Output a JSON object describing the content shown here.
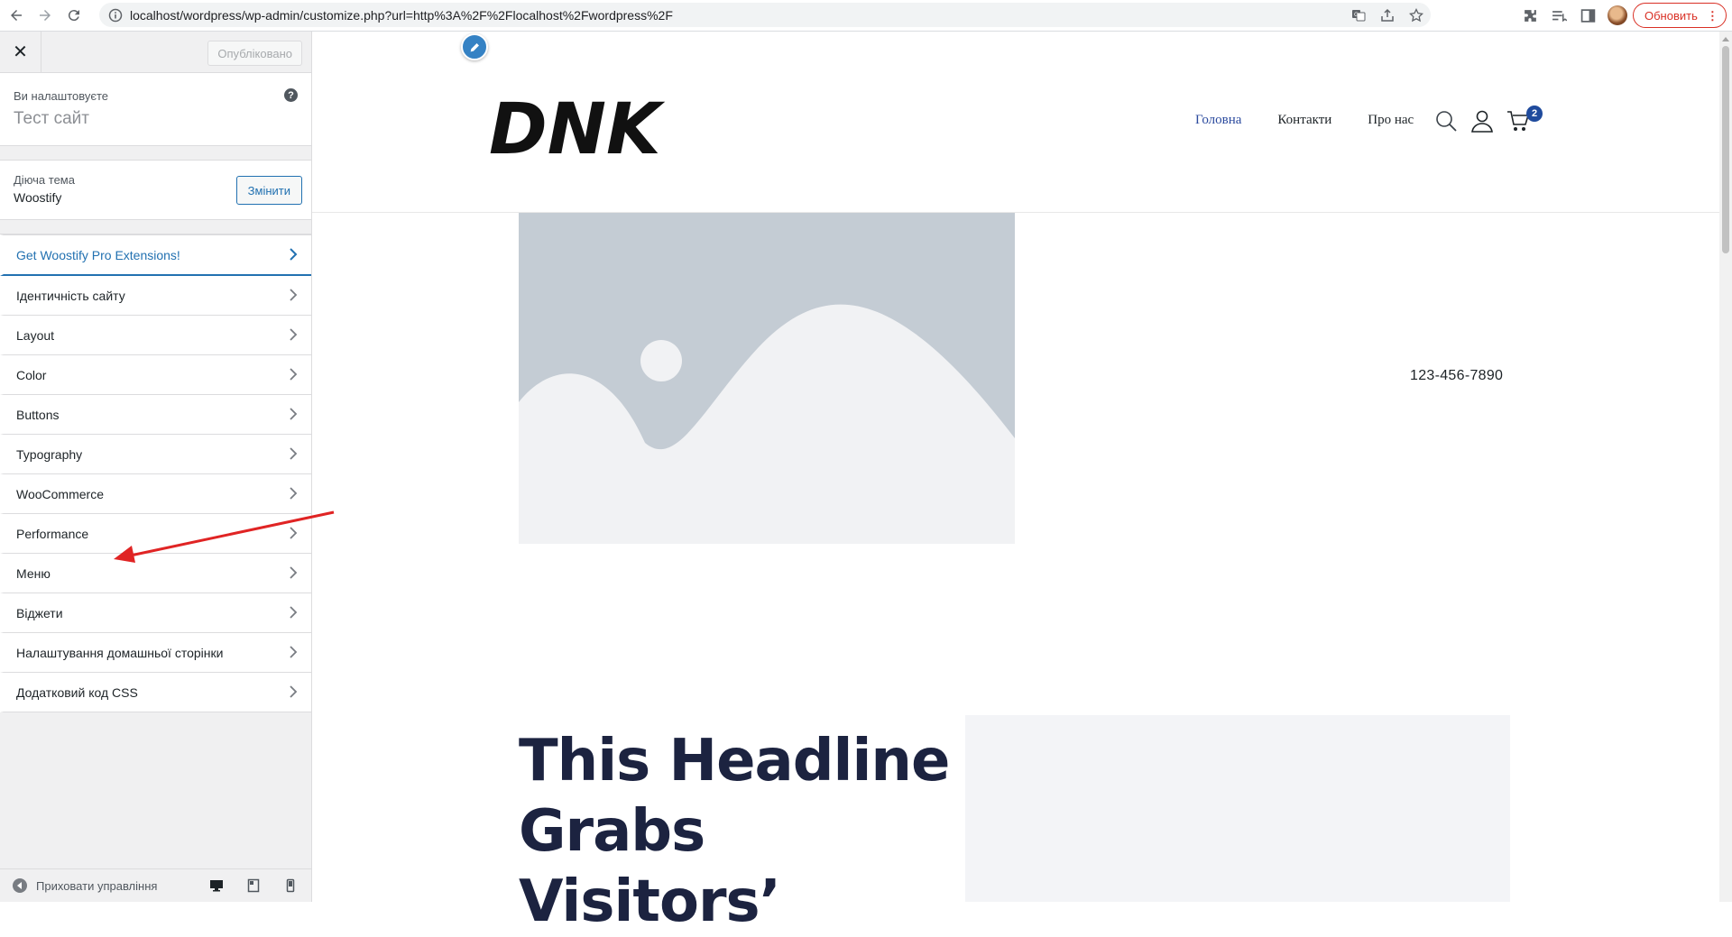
{
  "browser": {
    "url": "localhost/wordpress/wp-admin/customize.php?url=http%3A%2F%2Flocalhost%2Fwordpress%2F",
    "update_label": "Обновить",
    "menu_dots": "⋮"
  },
  "customizer": {
    "close_glyph": "✕",
    "published_label": "Опубліковано",
    "customizing_label": "Ви налаштовуєте",
    "site_title": "Тест сайт",
    "help_glyph": "?",
    "active_theme_label": "Діюча тема",
    "theme_name": "Woostify",
    "change_label": "Змінити",
    "panels": [
      {
        "label": "Get Woostify Pro Extensions!"
      },
      {
        "label": "Ідентичність сайту"
      },
      {
        "label": "Layout"
      },
      {
        "label": "Color"
      },
      {
        "label": "Buttons"
      },
      {
        "label": "Typography"
      },
      {
        "label": "WooCommerce"
      },
      {
        "label": "Performance"
      },
      {
        "label": "Меню"
      },
      {
        "label": "Віджети"
      },
      {
        "label": "Налаштування домашньої сторінки"
      },
      {
        "label": "Додатковий код CSS"
      }
    ],
    "hide_controls_label": "Приховати управління"
  },
  "preview": {
    "logo_text": "DNK",
    "nav": [
      {
        "label": "Головна",
        "active": true
      },
      {
        "label": "Контакти",
        "active": false
      },
      {
        "label": "Про нас",
        "active": false
      }
    ],
    "cart_count": "2",
    "phone": "123-456-7890",
    "headline": "This Headline Grabs Visitors’"
  },
  "colors": {
    "accent": "#2271b1",
    "nav_active": "#2b4a9e",
    "headline": "#1c2340",
    "annotation_arrow": "#e02424"
  }
}
